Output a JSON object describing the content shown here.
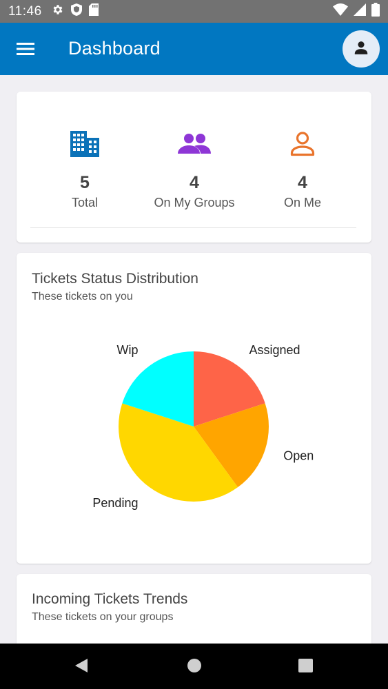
{
  "status_bar": {
    "time": "11:46",
    "icons": [
      "settings-gear-icon",
      "shield-icon",
      "sd-card-icon",
      "wifi-icon",
      "signal-icon",
      "battery-icon"
    ]
  },
  "app_bar": {
    "title": "Dashboard",
    "menu_icon": "hamburger-menu-icon",
    "avatar_icon": "person-icon",
    "color": "#0177c1"
  },
  "stats": [
    {
      "value": "5",
      "label": "Total",
      "icon": "building-icon",
      "color": "#0b72b8"
    },
    {
      "value": "4",
      "label": "On My Groups",
      "icon": "group-icon",
      "color": "#8e36d6"
    },
    {
      "value": "4",
      "label": "On Me",
      "icon": "person-outline-icon",
      "color": "#e9742c"
    }
  ],
  "status_card": {
    "title": "Tickets Status Distribution",
    "subtitle": "These tickets on you"
  },
  "trends_card": {
    "title": "Incoming Tickets Trends",
    "subtitle": "These tickets on your groups"
  },
  "chart_data": {
    "type": "pie",
    "labels": [
      "Assigned",
      "Open",
      "Pending",
      "Wip"
    ],
    "values": [
      1,
      1,
      2,
      1
    ],
    "colors": [
      "#fe6448",
      "#ffa500",
      "#ffd700",
      "#00ffff"
    ]
  },
  "nav_bar": {
    "icons": [
      "back-icon",
      "home-icon",
      "recents-icon"
    ]
  }
}
